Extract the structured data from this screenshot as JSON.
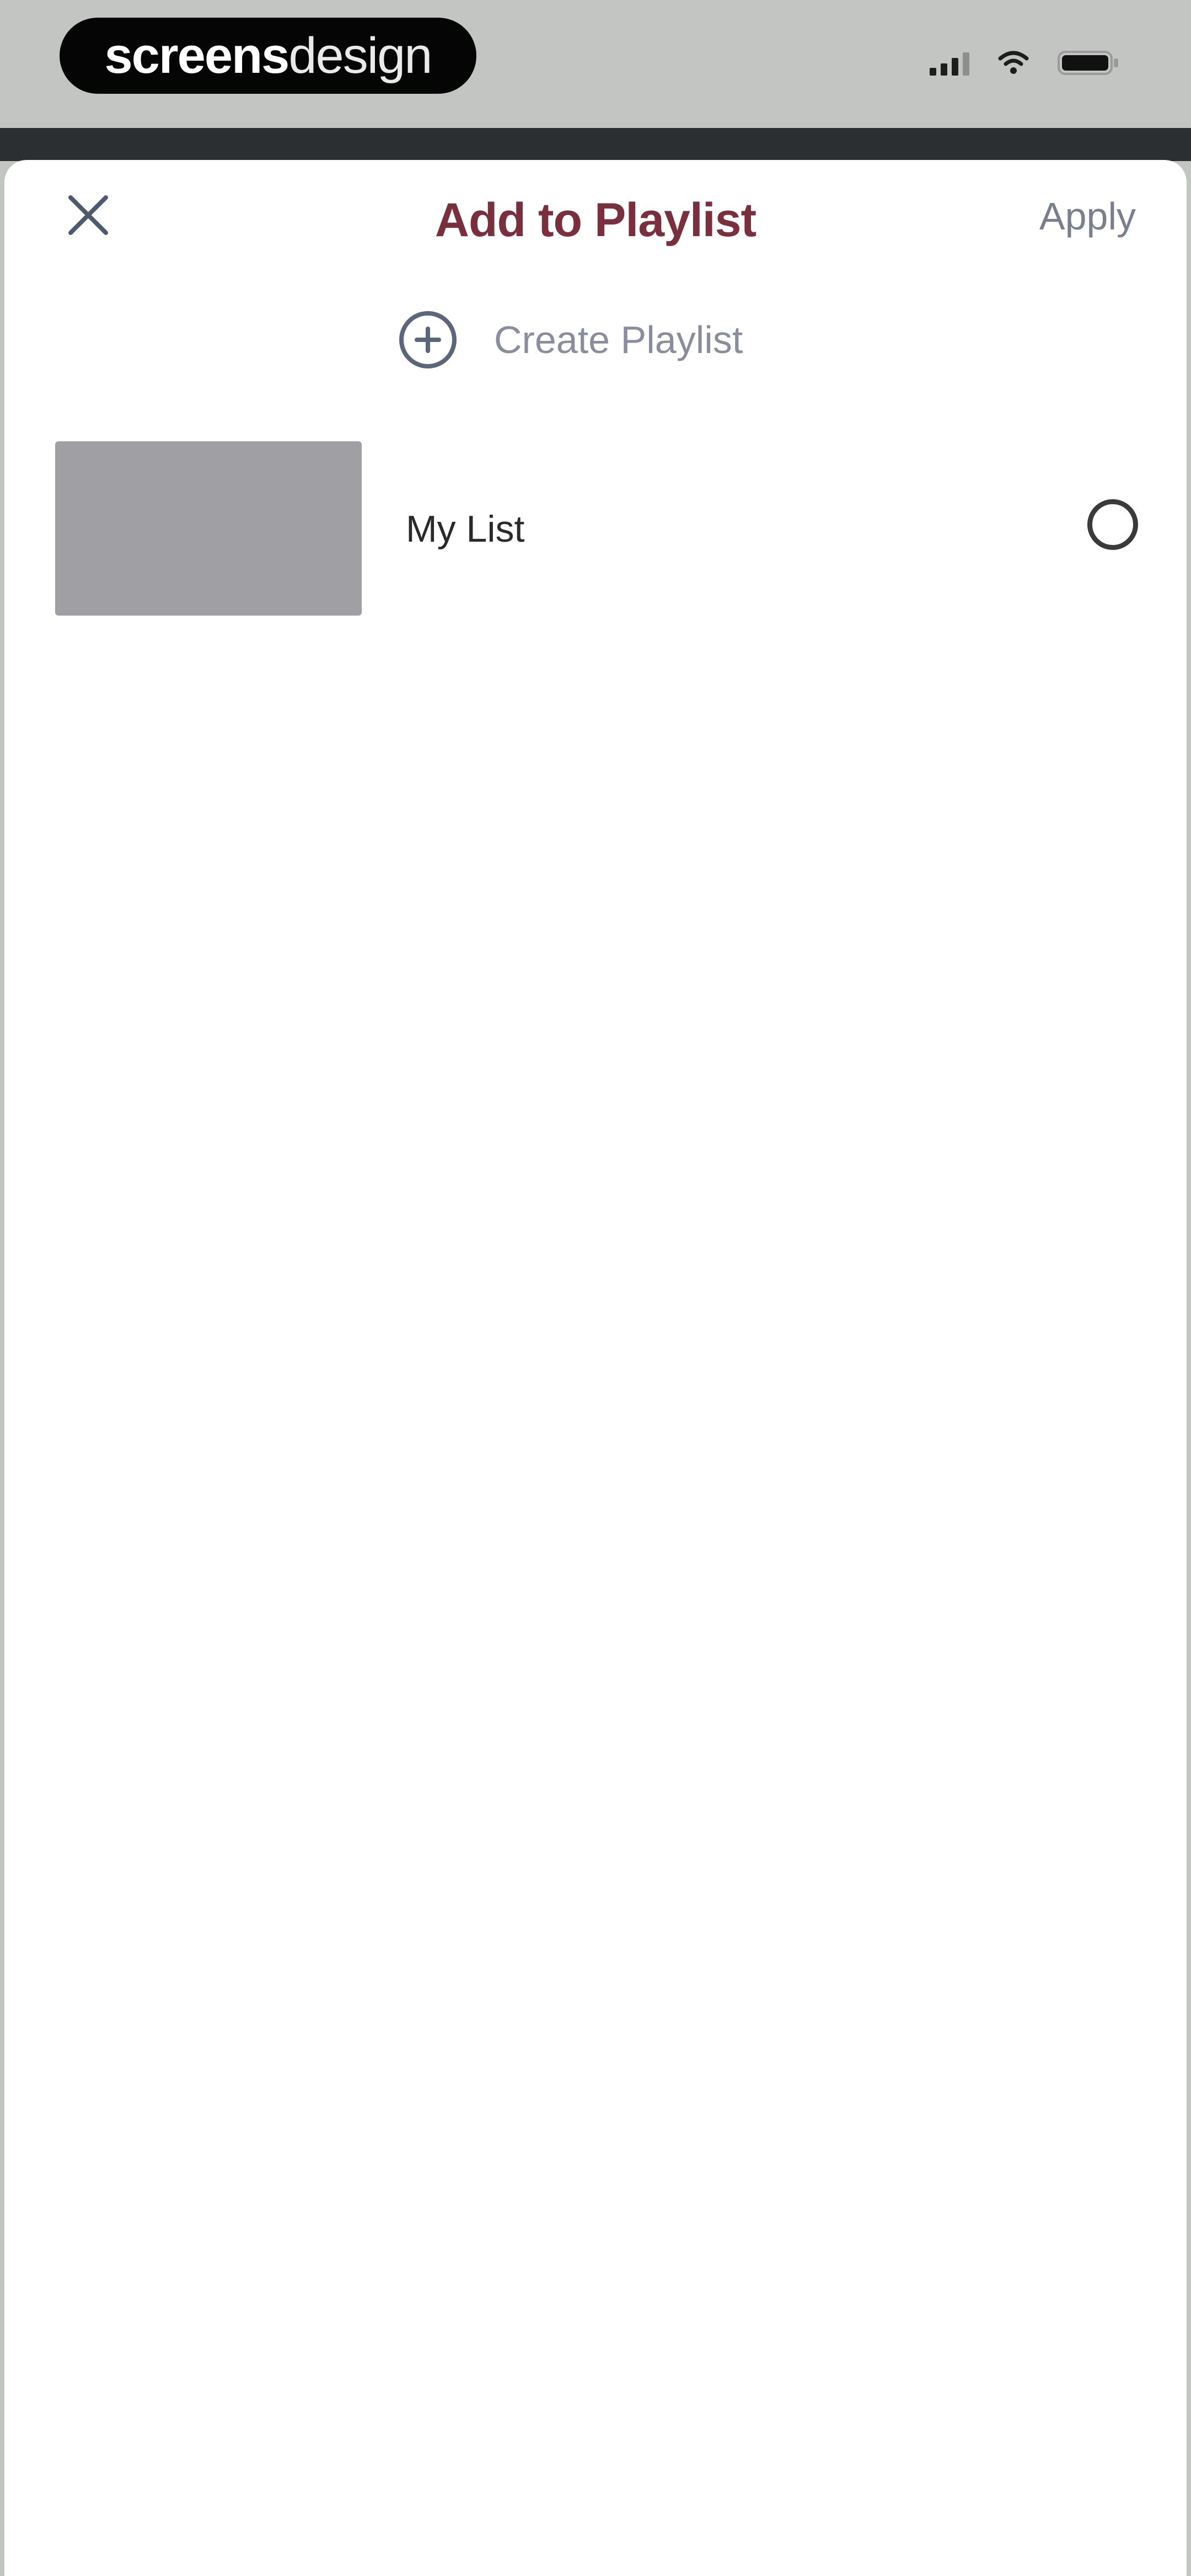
{
  "status_bar": {
    "logo_bold": "screens",
    "logo_light": "design",
    "signal_icon": "signal-icon",
    "wifi_icon": "wifi-icon",
    "battery_icon": "battery-icon"
  },
  "header": {
    "close_icon": "close-icon",
    "title": "Add to Playlist",
    "apply_label": "Apply"
  },
  "create": {
    "icon": "plus-circle-icon",
    "label": "Create Playlist"
  },
  "playlists": [
    {
      "name": "My List",
      "selected": false
    }
  ],
  "colors": {
    "title": "#7a2f3e",
    "apply": "#7a7f8e",
    "create_label": "#8a8e9c",
    "thumbnail": "#a0a0a4"
  }
}
